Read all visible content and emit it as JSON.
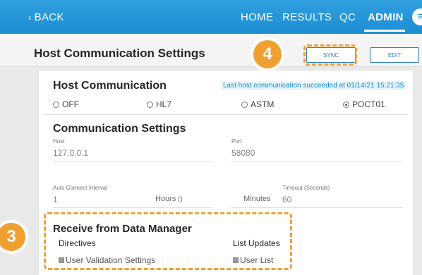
{
  "nav": {
    "back_label": "BACK",
    "items": [
      "HOME",
      "RESULTS",
      "QC",
      "ADMIN"
    ],
    "active": "ADMIN",
    "menu_icon": "hamburger-icon"
  },
  "header": {
    "title": "Host Communication Settings",
    "sync_label": "SYNC",
    "edit_label": "EDIT"
  },
  "callouts": {
    "step_4": "4",
    "step_3": "3"
  },
  "host_comm": {
    "title": "Host Communication",
    "status_message": "Last host communication succeeded at 01/14/21 15:21:35",
    "options": [
      "OFF",
      "HL7",
      "ASTM",
      "POCT01"
    ],
    "selected": "POCT01"
  },
  "comm_settings": {
    "title": "Communication Settings",
    "host_label": "Host",
    "host_value": "127.0.0.1",
    "port_label": "Port",
    "port_value": "58080",
    "auto_connect_label": "Auto Connect Interval",
    "auto_connect_value": "1",
    "hours_label": "Hours",
    "hours_value": "0",
    "minutes_label": "Minutes",
    "timeout_label": "Timeout (Seconds)",
    "timeout_value": "60"
  },
  "receive": {
    "title": "Receive from Data Manager",
    "directives_label": "Directives",
    "list_updates_label": "List Updates",
    "user_validation_label": "User Validation Settings",
    "user_list_label": "User List"
  },
  "colors": {
    "nav_bg": "#1e8ed4",
    "accent": "#f0a030",
    "link": "#1b86c6"
  }
}
